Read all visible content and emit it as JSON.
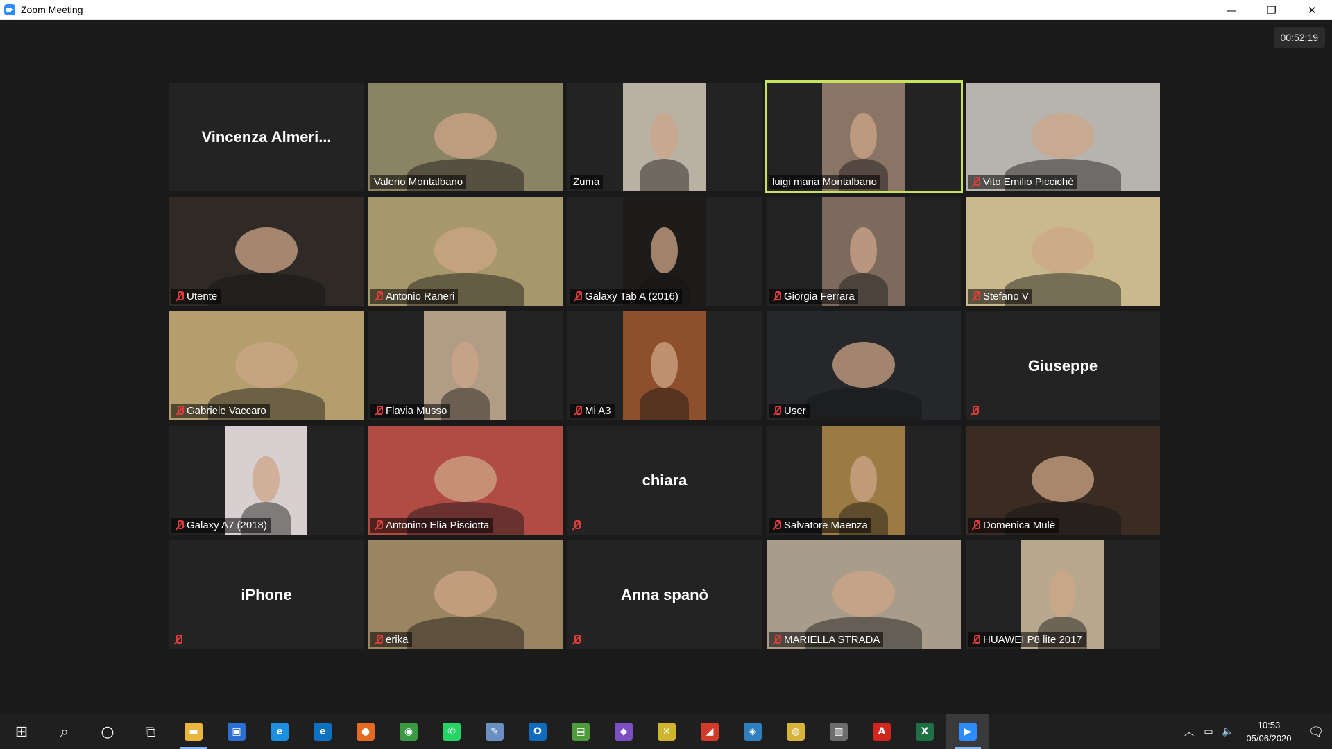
{
  "window": {
    "title": "Zoom Meeting",
    "minimize": "—",
    "restore": "❐",
    "close": "✕"
  },
  "meeting": {
    "timer": "00:52:19"
  },
  "participants": [
    {
      "name": "Vincenza  Almeri...",
      "video": false,
      "muted": false,
      "show_label": false
    },
    {
      "name": "Valerio Montalbano",
      "video": true,
      "muted": false,
      "bg": "#8a8464"
    },
    {
      "name": "Zuma",
      "video": true,
      "muted": false,
      "portrait": true,
      "bg": "#b9b1a3"
    },
    {
      "name": "luigi maria Montalbano",
      "video": true,
      "muted": false,
      "portrait": true,
      "active": true,
      "bg": "#8a7466"
    },
    {
      "name": "Vito Emilio Piccichè",
      "video": true,
      "muted": true,
      "bg": "#b7b4ae"
    },
    {
      "name": "Utente",
      "video": true,
      "muted": true,
      "bg": "#2f2a25"
    },
    {
      "name": "Antonio Raneri",
      "video": true,
      "muted": true,
      "bg": "#a6986a"
    },
    {
      "name": "Galaxy Tab A (2016)",
      "video": true,
      "muted": true,
      "portrait": true,
      "bg": "#1e1c1a"
    },
    {
      "name": "Giorgia Ferrara",
      "video": true,
      "muted": true,
      "portrait": true,
      "bg": "#7c6a5f"
    },
    {
      "name": "Stefano V",
      "video": true,
      "muted": true,
      "bg": "#c9b98c"
    },
    {
      "name": "Gabriele Vaccaro",
      "video": true,
      "muted": true,
      "bg": "#b59e6e"
    },
    {
      "name": "Flavia Musso",
      "video": true,
      "muted": true,
      "portrait": true,
      "bg": "#b19d86"
    },
    {
      "name": "Mi A3",
      "video": true,
      "muted": true,
      "portrait": true,
      "bg": "#8e4f2d"
    },
    {
      "name": "User",
      "video": true,
      "muted": true,
      "bg": "#25272b"
    },
    {
      "name": "Giuseppe",
      "video": false,
      "muted": true
    },
    {
      "name": "Galaxy A7 (2018)",
      "video": true,
      "muted": true,
      "portrait": true,
      "bg": "#d8cfd0"
    },
    {
      "name": "Antonino Elia Pisciotta",
      "video": true,
      "muted": true,
      "bg": "#b14c44"
    },
    {
      "name": "chiara",
      "video": false,
      "muted": true
    },
    {
      "name": "Salvatore Maenza",
      "video": true,
      "muted": true,
      "portrait": true,
      "bg": "#9c7a43"
    },
    {
      "name": "Domenica Mulè",
      "video": true,
      "muted": true,
      "bg": "#3a2c22"
    },
    {
      "name": "iPhone",
      "video": false,
      "muted": true
    },
    {
      "name": "erika",
      "video": true,
      "muted": true,
      "bg": "#9a8462"
    },
    {
      "name": "Anna spanò",
      "video": false,
      "muted": true
    },
    {
      "name": "MARIELLA STRADA",
      "video": true,
      "muted": true,
      "bg": "#a89c8a"
    },
    {
      "name": "HUAWEI P8 lite 2017",
      "video": true,
      "muted": true,
      "portrait": true,
      "bg": "#b6a78d"
    }
  ],
  "taskbar": {
    "apps": [
      {
        "name": "start-icon",
        "glyph": "⊞",
        "color": "#1f1f1f"
      },
      {
        "name": "search-icon",
        "glyph": "⌕",
        "color": "#1f1f1f"
      },
      {
        "name": "cortana-icon",
        "glyph": "○",
        "color": "#1f1f1f"
      },
      {
        "name": "task-view-icon",
        "glyph": "⧉",
        "color": "#1f1f1f"
      },
      {
        "name": "file-explorer-icon",
        "glyph": "▬",
        "color": "#e8b63c",
        "open": true
      },
      {
        "name": "store-icon",
        "glyph": "▣",
        "color": "#2a6fd1"
      },
      {
        "name": "internet-explorer-icon",
        "glyph": "e",
        "color": "#1d8fe1"
      },
      {
        "name": "edge-icon",
        "glyph": "e",
        "color": "#0e70c0"
      },
      {
        "name": "firefox-icon",
        "glyph": "●",
        "color": "#e66a22"
      },
      {
        "name": "chrome-icon",
        "glyph": "◉",
        "color": "#3a9a44"
      },
      {
        "name": "whatsapp-icon",
        "glyph": "✆",
        "color": "#25d366"
      },
      {
        "name": "tool-icon",
        "glyph": "✎",
        "color": "#6b8fbf"
      },
      {
        "name": "outlook-icon",
        "glyph": "O",
        "color": "#0f6cbd"
      },
      {
        "name": "image-app-icon",
        "glyph": "▤",
        "color": "#4f9a3b"
      },
      {
        "name": "visual-studio-icon",
        "glyph": "◆",
        "color": "#7a4fc2"
      },
      {
        "name": "app-icon-green",
        "glyph": "✕",
        "color": "#cfb52c"
      },
      {
        "name": "app-icon-red",
        "glyph": "◢",
        "color": "#d23b2a"
      },
      {
        "name": "app-icon-colorful",
        "glyph": "◈",
        "color": "#2f7fbf"
      },
      {
        "name": "app-icon-yellow",
        "glyph": "◍",
        "color": "#d8b33a"
      },
      {
        "name": "app-icon-server",
        "glyph": "▥",
        "color": "#6d6d6d"
      },
      {
        "name": "acrobat-icon",
        "glyph": "A",
        "color": "#d0261d"
      },
      {
        "name": "excel-icon",
        "glyph": "X",
        "color": "#1e7145"
      },
      {
        "name": "zoom-icon",
        "glyph": "▶",
        "color": "#2d8cff",
        "current": true
      }
    ],
    "tray": {
      "chevron": "︿",
      "network": "▭",
      "volume": "🔈"
    },
    "clock": {
      "time": "10:53",
      "date": "05/06/2020"
    },
    "notification": "🗨"
  }
}
